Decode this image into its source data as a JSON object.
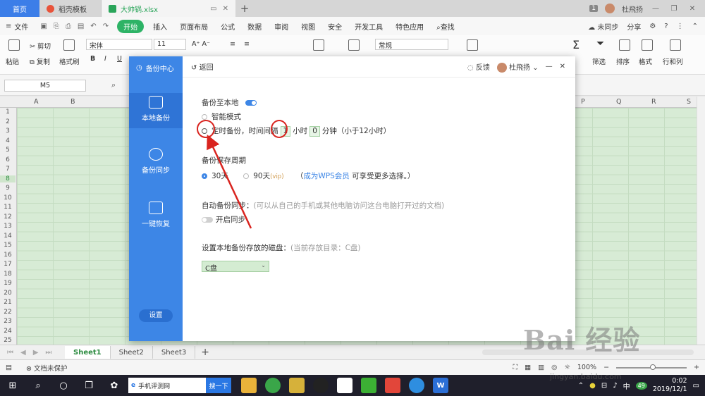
{
  "titlebar": {
    "home_tab": "首页",
    "doc_tab": "稻壳模板",
    "file_tab": "大帅锅.xlsx",
    "new_tab": "+",
    "badge": "1",
    "user": "杜飛扬"
  },
  "menubar": {
    "file": "文件",
    "items": [
      "开始",
      "插入",
      "页面布局",
      "公式",
      "数据",
      "审阅",
      "视图",
      "安全",
      "开发工具",
      "特色应用"
    ],
    "search": "查找",
    "sync": "未同步",
    "share": "分享"
  },
  "ribbon": {
    "paste": "粘贴",
    "cut": "剪切",
    "copy": "复制",
    "format_painter": "格式刷",
    "font_name": "宋体",
    "font_size": "11",
    "number_format": "常规",
    "right_cmds": [
      "筛选",
      "排序",
      "格式",
      "行和列"
    ]
  },
  "formulabar": {
    "namebox": "M5"
  },
  "grid": {
    "columns_left": [
      "A",
      "B"
    ],
    "columns_right": [
      "P",
      "Q",
      "R",
      "S"
    ],
    "rows": [
      "1",
      "2",
      "3",
      "4",
      "5",
      "6",
      "7",
      "8",
      "9",
      "10",
      "11",
      "12",
      "13",
      "14",
      "15",
      "16",
      "17",
      "18",
      "19",
      "20",
      "21",
      "22",
      "23",
      "24",
      "25"
    ]
  },
  "sheets": {
    "tabs": [
      "Sheet1",
      "Sheet2",
      "Sheet3"
    ],
    "active": "Sheet1",
    "add": "+"
  },
  "statusbar": {
    "protect": "文档未保护",
    "zoom": "100%"
  },
  "taskbar": {
    "search_text": "手机评测网",
    "search_btn": "搜一下",
    "ime": "中",
    "badge": "49",
    "time": "0:02",
    "date": "2019/12/1",
    "wps_label": "W"
  },
  "dialog": {
    "side_title": "备份中心",
    "side_items": [
      "本地备份",
      "备份同步",
      "一键恢复"
    ],
    "settings": "设置",
    "back": "返回",
    "feedback": "反馈",
    "user": "杜飛扬",
    "local_backup_title": "备份至本地",
    "smart_mode": "智能模式",
    "timed_prefix": "定时备份，时间间隔",
    "hour_value": "1",
    "hour_label": "小时",
    "minute_value": "0",
    "minute_label": "分钟（小于12小时）",
    "retention_title": "备份保存周期",
    "opt_30": "30天",
    "opt_90": "90天",
    "vip": "(vip)",
    "become_vip": "成为WPS会员",
    "more_choices": "可享受更多选择。）",
    "paren_open": "（",
    "auto_sync_title": "自动备份同步：",
    "auto_sync_hint": "(可以从自己的手机或其他电脑访问这台电脑打开过的文档)",
    "enable_sync": "开启同步",
    "disk_title": "设置本地备份存放的磁盘：",
    "disk_hint": "(当前存放目录：C盘)",
    "disk_value": "C盘"
  },
  "watermark": {
    "logo": "Bai  经验",
    "url": "jingyan.baidu.com"
  },
  "colors": {
    "accent": "#3d86e6",
    "start_green": "#2db366",
    "annotation": "#d9241f"
  }
}
